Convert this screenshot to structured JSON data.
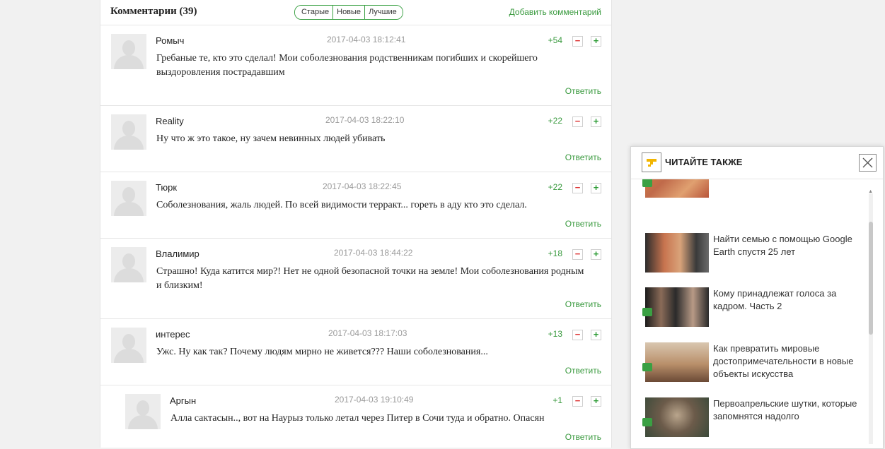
{
  "comments_header": {
    "title": "Комментарии (39)",
    "sort_tabs": [
      "Старые",
      "Новые",
      "Лучшие"
    ],
    "add_comment": "Добавить комментарий"
  },
  "comments": [
    {
      "author": "Ромыч",
      "date": "2017-04-03 18:12:41",
      "score": "+54",
      "text": "Гребаные те, кто это сделал! Мои соболезнования родственникам погибших и скорейшего выздоровления пострадавшим",
      "reply": "Ответить"
    },
    {
      "author": "Reality",
      "date": "2017-04-03 18:22:10",
      "score": "+22",
      "text": "Ну что ж это такое, ну зачем невинных людей убивать",
      "reply": "Ответить"
    },
    {
      "author": "Тюрк",
      "date": "2017-04-03 18:22:45",
      "score": "+22",
      "text": "Соболезнования, жаль людей. По всей видимости терракт... гореть в аду кто это сделал.",
      "reply": "Ответить"
    },
    {
      "author": "Влалимир",
      "date": "2017-04-03 18:44:22",
      "score": "+18",
      "text": "Страшно! Куда катится мир?! Нет не одной безопасной точки на земле! Мои соболезнования родным и близким!",
      "reply": "Ответить"
    },
    {
      "author": "интерес",
      "date": "2017-04-03 18:17:03",
      "score": "+13",
      "text": "Ужс. Ну как так? Почему людям мирно не живется??? Наши соболезнования...",
      "reply": "Ответить"
    },
    {
      "author": "Аргын",
      "date": "2017-04-03 19:10:49",
      "score": "+1",
      "text": "Алла сактасын.., вот на Наурыз только летал через Питер в Сочи туда и обратно. Опасян",
      "reply": "Ответить"
    }
  ],
  "vote": {
    "minus": "−",
    "plus": "+"
  },
  "read_also": {
    "title": "ЧИТАЙТЕ ТАКЖЕ",
    "close_icon": "close-icon",
    "items": [
      {
        "title": "",
        "badge": "video-icon"
      },
      {
        "title": "Найти семью с помощью Google Earth спустя 25 лет",
        "badge": ""
      },
      {
        "title": "Кому принадлежат голоса за кадром. Часть 2",
        "badge": "video-icon"
      },
      {
        "title": "Как превратить мировые достопримечательности в новые объекты искусства",
        "badge": "photo-icon"
      },
      {
        "title": "Первоапрельские шутки, которые запомнятся надолго",
        "badge": "photo-icon"
      }
    ]
  },
  "colors": {
    "accent_green": "#3a9a3f",
    "minus_red": "#dd3333",
    "badge_green": "#3aa043"
  }
}
